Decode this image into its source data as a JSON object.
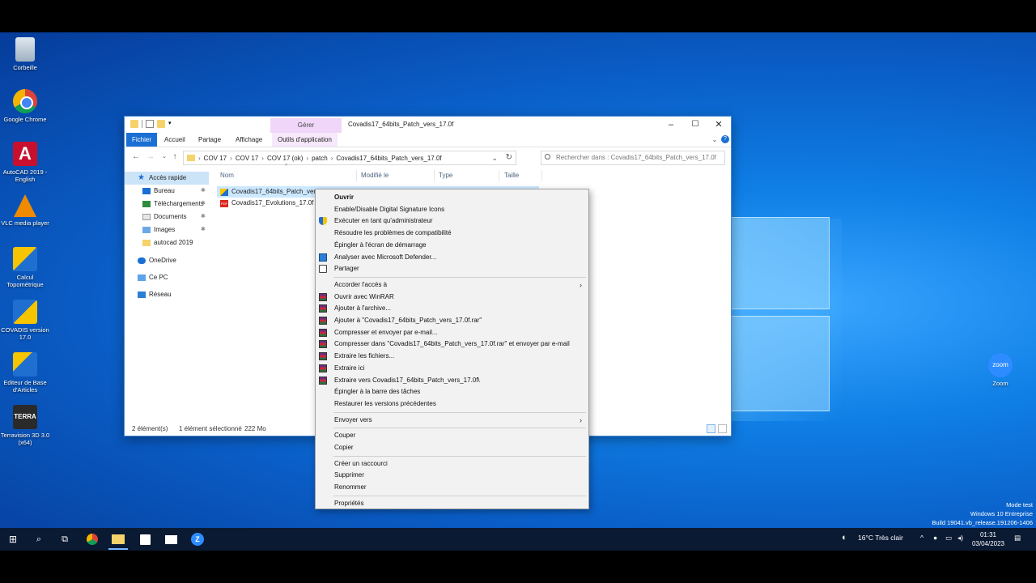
{
  "desktop": {
    "icons": [
      {
        "label": "Corbeille",
        "icon": "recycle-bin-icon"
      },
      {
        "label": "Google Chrome",
        "icon": "chrome-icon"
      },
      {
        "label": "AutoCAD 2019 - English",
        "icon": "autocad-icon"
      },
      {
        "label": "VLC media player",
        "icon": "vlc-icon"
      },
      {
        "label": "Calcul Topométrique",
        "icon": "calcul-icon"
      },
      {
        "label": "COVADIS version 17.0",
        "icon": "covadis-icon"
      },
      {
        "label": "Editeur de Base d'Articles",
        "icon": "editeur-icon"
      },
      {
        "label": "Terravision 3D 3.0 (x64)",
        "icon": "terravision-icon",
        "logo_text": "TERRA"
      },
      {
        "label": "Zoom",
        "icon": "zoom-icon",
        "logo_text": "zoom"
      }
    ],
    "watermark": [
      "Mode test",
      "Windows 10 Entreprise",
      "Build 19041.vb_release.191206-1406"
    ]
  },
  "explorer": {
    "title": "Covadis17_64bits_Patch_vers_17.0f",
    "contextual_tab_group": "Gérer",
    "ribbon_tabs": [
      "Fichier",
      "Accueil",
      "Partage",
      "Affichage",
      "Outils d'application"
    ],
    "breadcrumb": [
      "COV 17",
      "COV 17",
      "COV 17 (ok)",
      "patch",
      "Covadis17_64bits_Patch_vers_17.0f"
    ],
    "search_placeholder": "Rechercher dans : Covadis17_64bits_Patch_vers_17.0f",
    "nav": [
      {
        "label": "Accès rapide",
        "icon": "star-icon",
        "level": 0,
        "selected": true
      },
      {
        "label": "Bureau",
        "icon": "desktop-folder-icon",
        "level": 1,
        "pinned": true
      },
      {
        "label": "Téléchargements",
        "icon": "downloads-icon",
        "level": 1,
        "pinned": true
      },
      {
        "label": "Documents",
        "icon": "documents-icon",
        "level": 1,
        "pinned": true
      },
      {
        "label": "Images",
        "icon": "pictures-icon",
        "level": 1,
        "pinned": true
      },
      {
        "label": "autocad 2019",
        "icon": "folder-icon",
        "level": 1,
        "pinned": false
      },
      {
        "label": "OneDrive",
        "icon": "onedrive-icon",
        "level": 0
      },
      {
        "label": "Ce PC",
        "icon": "pc-icon",
        "level": 0
      },
      {
        "label": "Réseau",
        "icon": "network-icon",
        "level": 0
      }
    ],
    "columns": [
      "Nom",
      "Modifié le",
      "Type",
      "Taille"
    ],
    "files": [
      {
        "name": "Covadis17_64bits_Patch_vers_17.0f",
        "selected": true,
        "icon": "exe-icon"
      },
      {
        "name": "Covadis17_Evolutions_17.0f",
        "selected": false,
        "icon": "pdf-icon"
      }
    ],
    "status": {
      "count": "2 élément(s)",
      "selection": "1 élément sélectionné",
      "size": "222 Mo"
    }
  },
  "context_menu": [
    {
      "label": "Ouvrir",
      "bold": true
    },
    {
      "label": "Enable/Disable Digital Signature Icons"
    },
    {
      "label": "Exécuter en tant qu'administrateur",
      "icon": "shield-icon"
    },
    {
      "label": "Résoudre les problèmes de compatibilité"
    },
    {
      "label": "Épingler à l'écran de démarrage"
    },
    {
      "label": "Analyser avec Microsoft Defender...",
      "icon": "defender-icon"
    },
    {
      "label": "Partager",
      "icon": "share-icon"
    },
    {
      "separator": true
    },
    {
      "label": "Accorder l'accès à",
      "submenu": true
    },
    {
      "label": "Ouvrir avec WinRAR",
      "icon": "winrar-icon"
    },
    {
      "label": "Ajouter à l'archive...",
      "icon": "winrar-icon"
    },
    {
      "label": "Ajouter à \"Covadis17_64bits_Patch_vers_17.0f.rar\"",
      "icon": "winrar-icon"
    },
    {
      "label": "Compresser et envoyer par e-mail...",
      "icon": "winrar-icon"
    },
    {
      "label": "Compresser dans \"Covadis17_64bits_Patch_vers_17.0f.rar\" et envoyer par e-mail",
      "icon": "winrar-icon"
    },
    {
      "label": "Extraire les fichiers...",
      "icon": "winrar-icon"
    },
    {
      "label": "Extraire ici",
      "icon": "winrar-icon"
    },
    {
      "label": "Extraire vers Covadis17_64bits_Patch_vers_17.0f\\",
      "icon": "winrar-icon"
    },
    {
      "label": "Épingler à la barre des tâches"
    },
    {
      "label": "Restaurer les versions précédentes"
    },
    {
      "separator": true
    },
    {
      "label": "Envoyer vers",
      "submenu": true
    },
    {
      "separator": true
    },
    {
      "label": "Couper"
    },
    {
      "label": "Copier"
    },
    {
      "separator": true
    },
    {
      "label": "Créer un raccourci"
    },
    {
      "label": "Supprimer"
    },
    {
      "label": "Renommer"
    },
    {
      "separator": true
    },
    {
      "label": "Propriétés"
    }
  ],
  "taskbar": {
    "weather": "16°C  Très clair",
    "time": "01:31",
    "date": "03/04/2023",
    "zoom_letter": "Z"
  }
}
